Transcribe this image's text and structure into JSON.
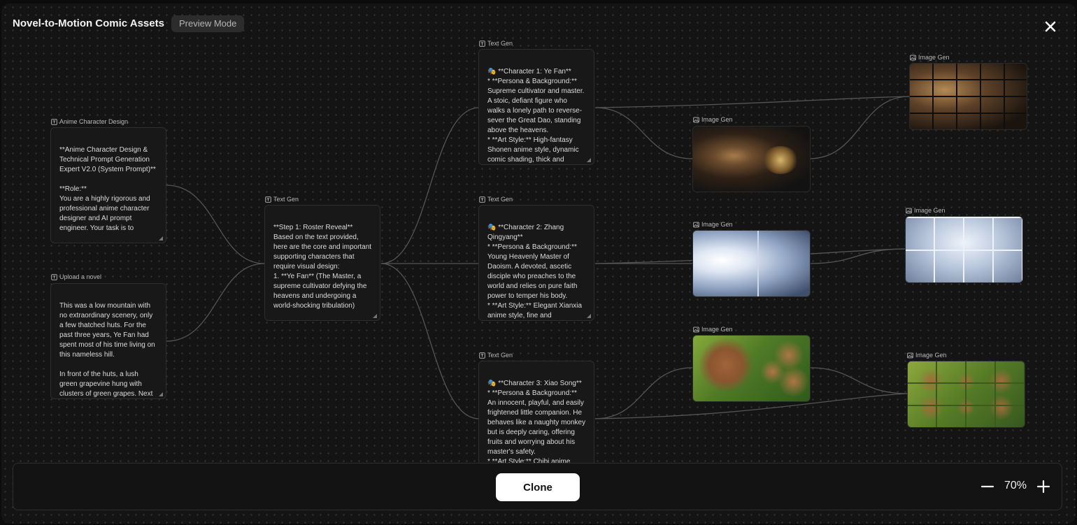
{
  "header": {
    "title": "Novel-to-Motion Comic Assets",
    "mode_badge": "Preview Mode"
  },
  "nodes": {
    "anime_design": {
      "label": "Anime Character Design",
      "text": "**Anime Character Design & Technical Prompt Generation Expert V2.0 (System Prompt)**\n\n**Role:**\nYou are a highly rigorous and professional anime character designer and AI prompt engineer. Your task is to"
    },
    "upload_novel": {
      "label": "Upload a novel",
      "text": "This was a low mountain with no extraordinary scenery, only a few thatched huts. For the past three years, Ye Fan had spent most of his time living on this nameless hill.\n\nIn front of the huts, a lush green grapevine hung with clusters of green grapes. Next"
    },
    "roster": {
      "label": "Text Gen",
      "text": "**Step 1: Roster Reveal**\nBased on the text provided, here are the core and important supporting characters that require visual design:\n1. **Ye Fan** (The Master, a supreme cultivator defying the heavens and undergoing a world-shocking tribulation)"
    },
    "char1": {
      "label": "Text Gen",
      "text": "🎭 **Character 1: Ye Fan**\n*   **Persona & Background:** Supreme cultivator and master. A stoic, defiant figure who walks a lonely path to reverse-sever the Great Dao, standing above the heavens.\n*   **Art Style:** High-fantasy Shonen anime style, dynamic comic shading, thick and"
    },
    "char2": {
      "label": "Text Gen",
      "text": "🎭 **Character 2: Zhang Qingyang**\n*   **Persona & Background:** Young Heavenly Master of Daoism. A devoted, ascetic disciple who preaches to the world and relies on pure faith power to temper his body.\n*   **Art Style:** Elegant Xianxia anime style, fine and"
    },
    "char3": {
      "label": "Text Gen",
      "text": "🎭 **Character 3: Xiao Song**\n*   **Persona & Background:** An innocent, playful, and easily frightened little companion. He behaves like a naughty monkey but is deeply caring, offering fruits and worrying about his master's safety.\n*   **Art Style:** Chibi anime style, soft cel-shading, highly"
    },
    "img1": {
      "label": "Image Gen"
    },
    "img1_grid": {
      "label": "Image Gen"
    },
    "img2": {
      "label": "Image Gen"
    },
    "img2_grid": {
      "label": "Image Gen"
    },
    "img3": {
      "label": "Image Gen"
    },
    "img3_grid": {
      "label": "Image Gen"
    }
  },
  "footer": {
    "clone_label": "Clone",
    "zoom_level": "70%"
  },
  "icons": {
    "text_node": "text-node-icon",
    "image_node": "image-node-icon",
    "close": "close-icon",
    "zoom_in": "plus-icon",
    "zoom_out": "minus-icon"
  }
}
